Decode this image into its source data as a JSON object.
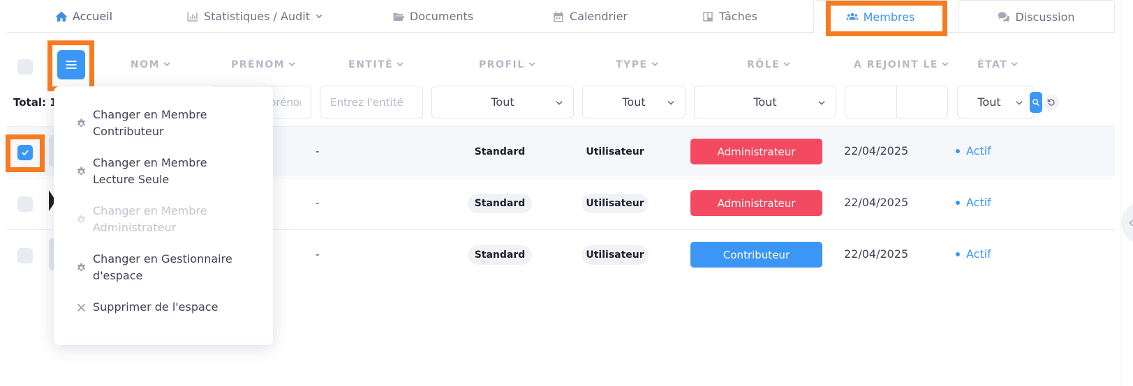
{
  "tabs": [
    {
      "label": "Accueil",
      "icon": "home-icon"
    },
    {
      "label": "Statistiques / Audit",
      "icon": "bar-chart-icon"
    },
    {
      "label": "Documents",
      "icon": "folder-open-icon"
    },
    {
      "label": "Calendrier",
      "icon": "calendar-icon"
    },
    {
      "label": "Tâches",
      "icon": "board-icon"
    },
    {
      "label": "Membres",
      "icon": "users-icon",
      "active": true
    },
    {
      "label": "Discussion",
      "icon": "comments-icon"
    }
  ],
  "columns": {
    "nom": "NOM",
    "prenom": "PRÉNOM",
    "entite": "ENTITÉ",
    "profil": "PROFIL",
    "type": "TYPE",
    "role": "RÔLE",
    "joined": "A REJOINT LE",
    "etat": "ÉTAT"
  },
  "filters": {
    "total_label": "Total: 1",
    "prenom_placeholder": "Entrez le prénom",
    "entite_placeholder": "Entrez l'entité",
    "profil": "Tout",
    "type": "Tout",
    "role": "Tout",
    "etat": "Tout"
  },
  "rows": [
    {
      "entite": "-",
      "profil": "Standard",
      "type": "Utilisateur",
      "role": "Administrateur",
      "joined": "22/04/2025",
      "etat": "Actif",
      "checked": true
    },
    {
      "entite": "-",
      "profil": "Standard",
      "type": "Utilisateur",
      "role": "Administrateur",
      "joined": "22/04/2025",
      "etat": "Actif",
      "checked": false
    },
    {
      "entite": "-",
      "profil": "Standard",
      "type": "Utilisateur",
      "role": "Contributeur",
      "joined": "22/04/2025",
      "etat": "Actif",
      "checked": false
    }
  ],
  "bulk_menu": {
    "items": [
      {
        "label_1": "Changer en Membre",
        "label_2": "Contributeur",
        "icon": "gear-icon",
        "disabled": false
      },
      {
        "label_1": "Changer en Membre",
        "label_2": "Lecture Seule",
        "icon": "gear-icon",
        "disabled": false
      },
      {
        "label_1": "Changer en Membre",
        "label_2": "Administrateur",
        "icon": "gear-icon",
        "disabled": true
      },
      {
        "label_1": "Changer en Gestionnaire",
        "label_2": "d'espace",
        "icon": "gear-icon",
        "disabled": false
      },
      {
        "label_1": "Supprimer de l'espace",
        "icon": "close-icon",
        "disabled": false
      }
    ]
  },
  "colors": {
    "accent": "#3b96f5",
    "admin_badge": "#f34a61",
    "highlight": "#f97b1f",
    "muted": "#b5b9c9"
  }
}
